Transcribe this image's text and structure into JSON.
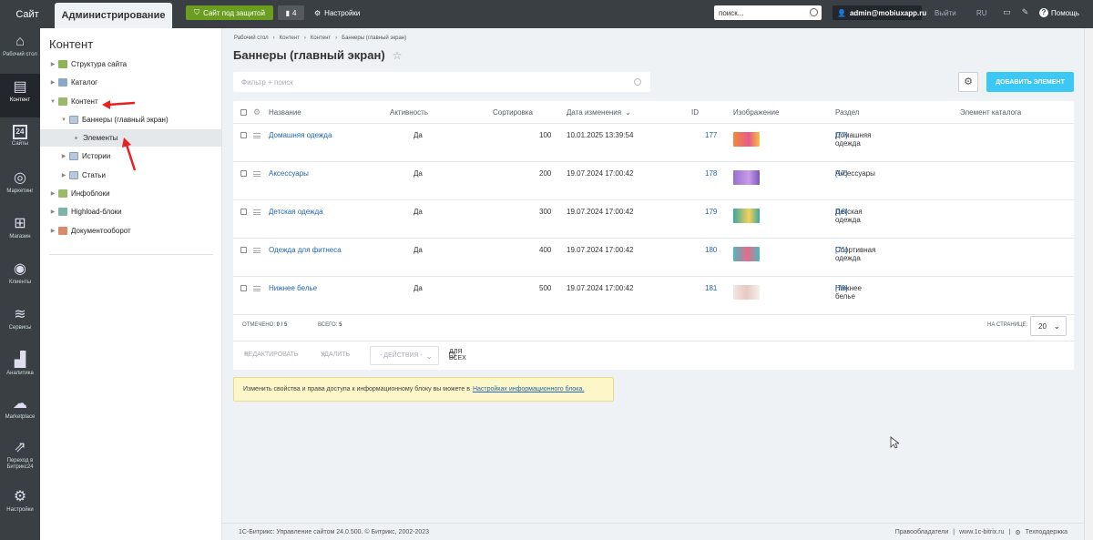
{
  "topbar": {
    "site_tab": "Сайт",
    "admin_tab": "Администрирование",
    "protected_label": "Сайт под защитой",
    "notifications_count": "4",
    "settings_label": "Настройки",
    "search_placeholder": "поиск...",
    "user_label": "admin@mobiuxapp.ru",
    "logout_label": "Выйти",
    "lang_label": "RU",
    "help_label": "Помощь"
  },
  "leftnav": {
    "items": [
      {
        "label": "Рабочий стол",
        "icon": "home-icon"
      },
      {
        "label": "Контент",
        "icon": "document-icon"
      },
      {
        "label": "Сайты",
        "icon": "calendar-icon",
        "icon_text": "24"
      },
      {
        "label": "Маркетинг",
        "icon": "target-icon"
      },
      {
        "label": "Магазин",
        "icon": "cart-icon"
      },
      {
        "label": "Клиенты",
        "icon": "clients-icon"
      },
      {
        "label": "Сервисы",
        "icon": "layers-icon"
      },
      {
        "label": "Аналитика",
        "icon": "chart-icon"
      },
      {
        "label": "Marketplace",
        "icon": "cloud-icon"
      },
      {
        "label": "Переход в Битрикс24",
        "icon": "transfer-icon"
      },
      {
        "label": "Настройки",
        "icon": "gear-icon"
      }
    ]
  },
  "tree": {
    "title": "Контент",
    "items": [
      {
        "label": "Структура сайта"
      },
      {
        "label": "Каталог"
      },
      {
        "label": "Контент"
      },
      {
        "label": "Баннеры (главный экран)"
      },
      {
        "label": "Элементы"
      },
      {
        "label": "Истории"
      },
      {
        "label": "Статьи"
      },
      {
        "label": "Инфоблоки"
      },
      {
        "label": "Highload-блоки"
      },
      {
        "label": "Документооборот"
      }
    ]
  },
  "main": {
    "breadcrumb": [
      "Рабочий стол",
      "Контент",
      "Контент",
      "Баннеры (главный экран)"
    ],
    "title": "Баннеры (главный экран)",
    "filter_placeholder": "Фильтр + поиск",
    "add_button": "ДОБАВИТЬ ЭЛЕМЕНТ",
    "columns": {
      "name": "Название",
      "active": "Активность",
      "sort": "Сортировка",
      "date": "Дата изменения",
      "id": "ID",
      "image": "Изображение",
      "section": "Раздел",
      "catalog": "Элемент каталога"
    },
    "rows": [
      {
        "name": "Домашняя одежда",
        "active": "Да",
        "sort": "100",
        "date": "10.01.2025 13:39:54",
        "id": "177",
        "section": "Домашняя одежда",
        "section_id": "[77]",
        "thumb_color": "#f08a3c"
      },
      {
        "name": "Аксессуары",
        "active": "Да",
        "sort": "200",
        "date": "19.07.2024 17:00:42",
        "id": "178",
        "section": "Аксессуары",
        "section_id": "[17]",
        "thumb_color": "#9b6fd0"
      },
      {
        "name": "Детская одежда",
        "active": "Да",
        "sort": "300",
        "date": "19.07.2024 17:00:42",
        "id": "179",
        "section": "Детская одежда",
        "section_id": "[16]",
        "thumb_color": "#3aa8a0"
      },
      {
        "name": "Одежда для фитнеса",
        "active": "Да",
        "sort": "400",
        "date": "19.07.2024 17:00:42",
        "id": "180",
        "section": "Спортивная одежда",
        "section_id": "[71]",
        "thumb_color": "#4cb8c0"
      },
      {
        "name": "Нижнее белье",
        "active": "Да",
        "sort": "500",
        "date": "19.07.2024 17:00:42",
        "id": "181",
        "section": "Нижнее белье",
        "section_id": "[79]",
        "thumb_color": "#e7c9c3"
      }
    ],
    "marked_label": "ОТМЕЧЕНО:",
    "marked_value": "0 / 5",
    "total_label": "ВСЕГО:",
    "total_value": "5",
    "per_page_label": "НА СТРАНИЦЕ:",
    "per_page_value": "20",
    "edit_label": "РЕДАКТИРОВАТЬ",
    "delete_label": "УДАЛИТЬ",
    "actions_label": "- ДЕЙСТВИЯ -",
    "for_all_label": "ДЛЯ ВСЕХ",
    "notice_text": "Изменить свойства и права доступа к информационному блоку вы можете в",
    "notice_link": "Настройках информационного блока."
  },
  "footer": {
    "copyright": "1С-Битрикс: Управление сайтом 24.0.500. © Битрикс, 2002-2023",
    "rights": "Правообладатели",
    "site": "www.1c-bitrix.ru",
    "support": "Техподдержка"
  },
  "colors": {
    "accent": "#3bc8f5",
    "protect_green": "#6b9e20",
    "link": "#2067b0",
    "annotation_red": "#e8201f"
  }
}
